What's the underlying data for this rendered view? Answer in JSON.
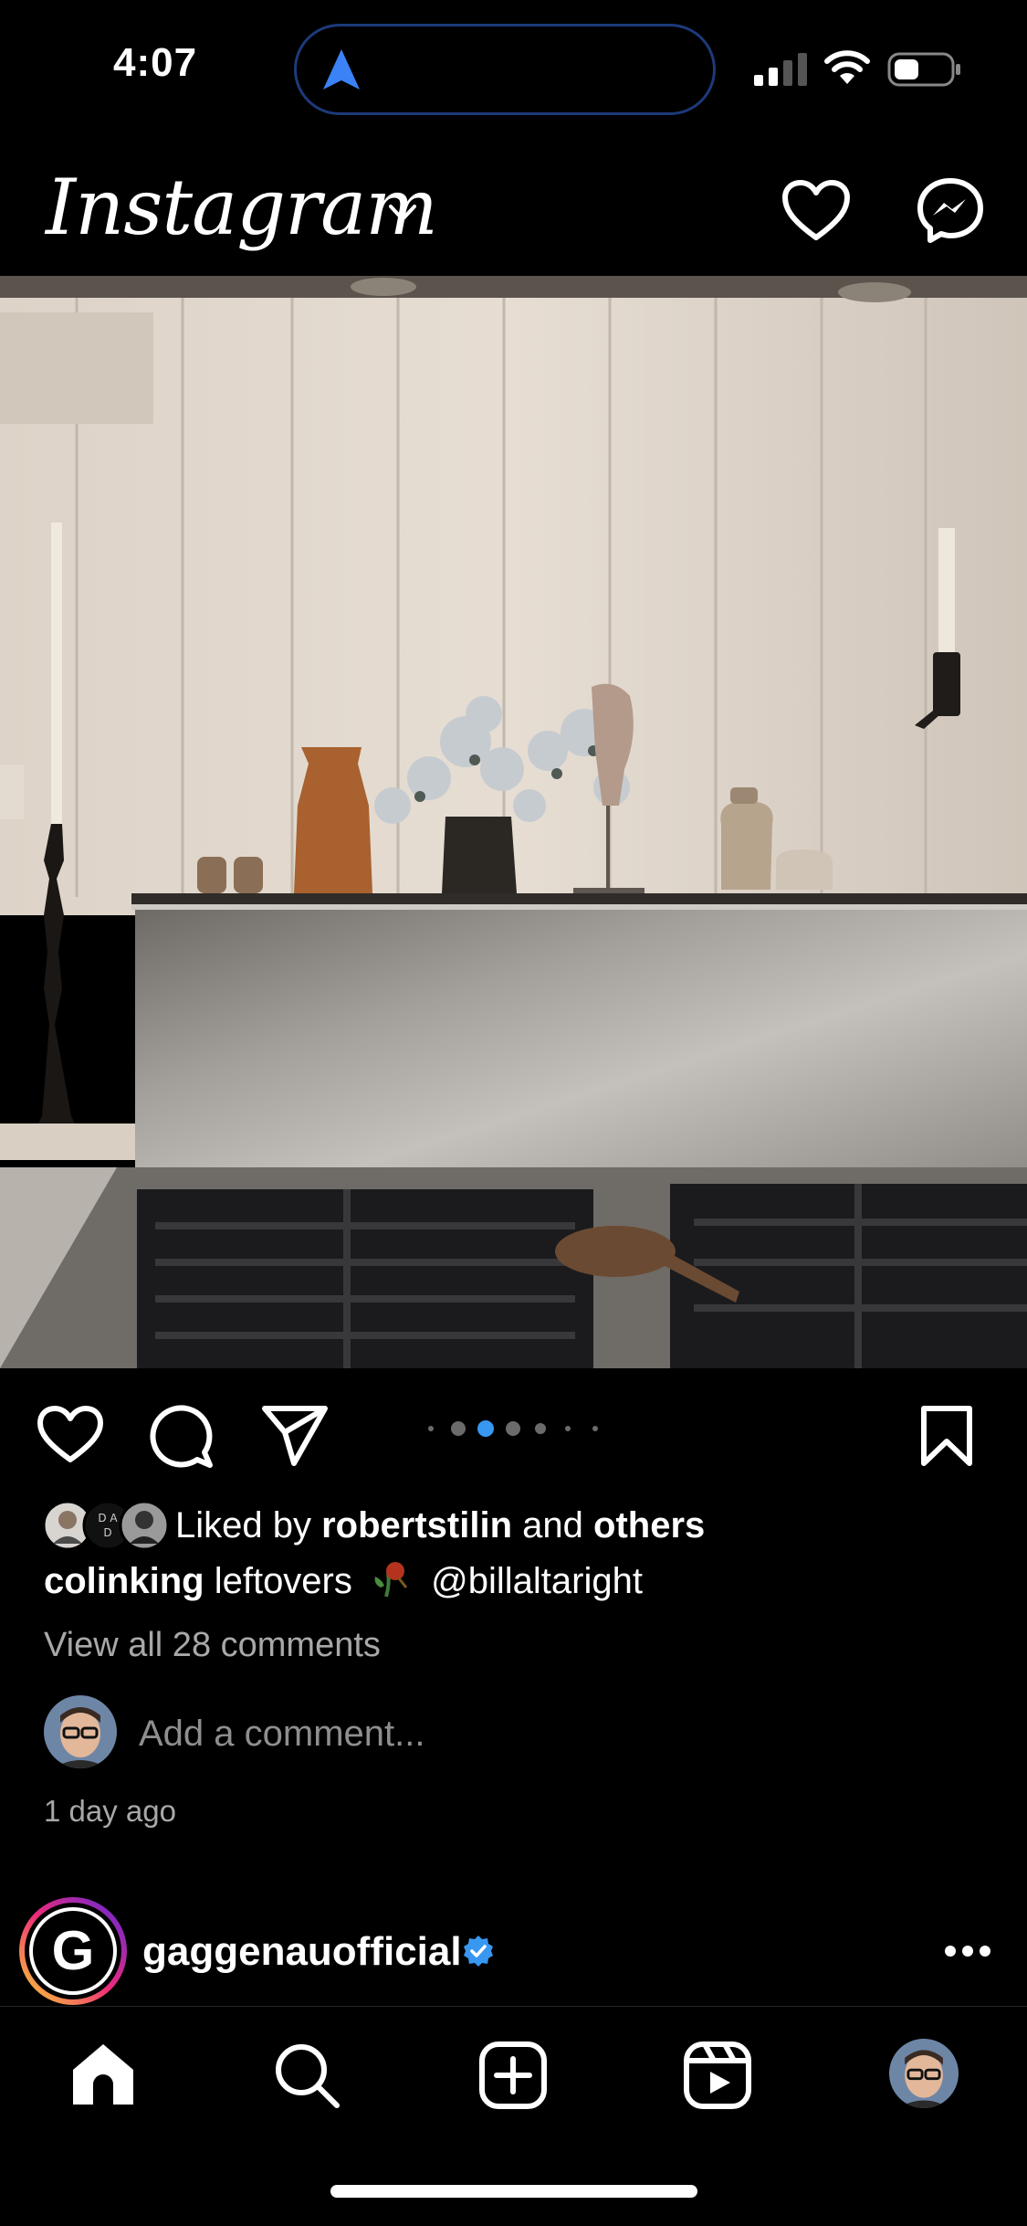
{
  "status_bar": {
    "time": "4:07"
  },
  "header": {
    "app_title": "Instagram"
  },
  "post": {
    "likes": {
      "prefix": "Liked by",
      "user": "robertstilin",
      "and": "and",
      "others": "others"
    },
    "caption": {
      "username": "colinking",
      "text": "leftovers",
      "mention": "@billaltaright"
    },
    "view_comments": "View all 28 comments",
    "add_comment_placeholder": "Add a comment...",
    "timestamp": "1 day ago",
    "carousel": {
      "count": 7,
      "active_index": 2
    }
  },
  "next_post": {
    "username": "gaggenauofficial",
    "verified": true,
    "avatar_letter": "G"
  },
  "colors": {
    "accent_blue": "#3897f0",
    "background": "#000000",
    "muted_text": "#a8a8a8"
  },
  "icons": {
    "header": [
      "heart-icon",
      "messenger-icon"
    ],
    "actions": [
      "like-icon",
      "comment-icon",
      "share-icon",
      "save-icon"
    ],
    "bottom_nav": [
      "home-icon",
      "search-icon",
      "create-icon",
      "reels-icon",
      "profile-avatar"
    ]
  }
}
